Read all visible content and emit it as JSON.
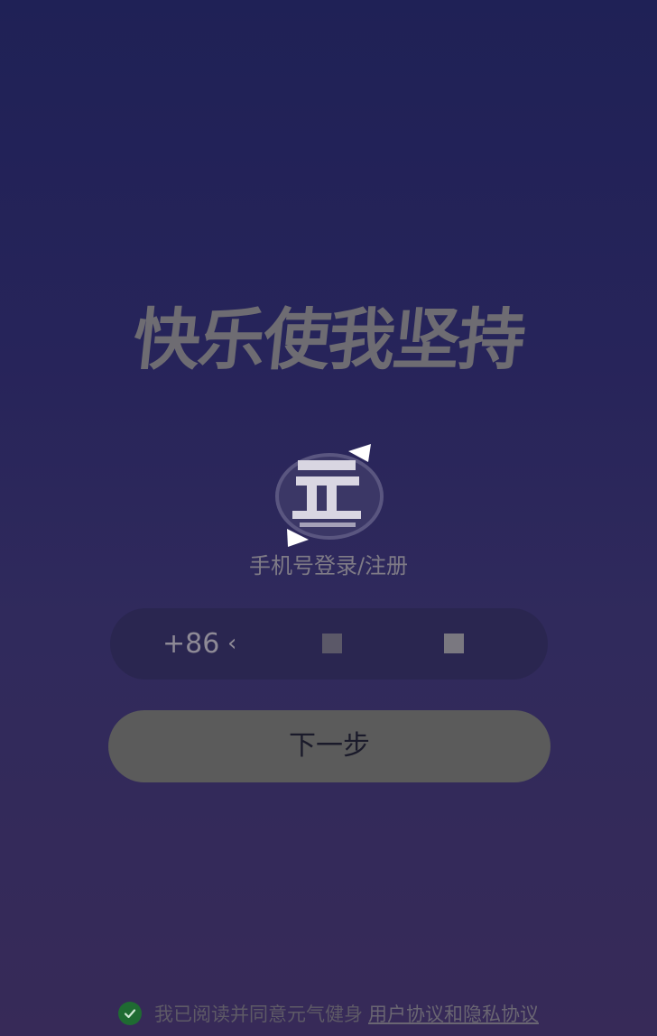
{
  "slogan": "快乐使我坚持",
  "logo": {
    "icon": "yuanqi-logo-icon"
  },
  "login": {
    "caption": "手机号登录/注册",
    "country_code": "+86",
    "phone_value": "",
    "next_button": "下一步"
  },
  "agreement": {
    "checkbox_icon": "check-circle-icon",
    "text": "我已阅读并同意元气健身",
    "link": "用户协议和隐私协议"
  },
  "colors": {
    "accent_check": "#1f6b32",
    "button_bg": "#5b5b5b"
  }
}
